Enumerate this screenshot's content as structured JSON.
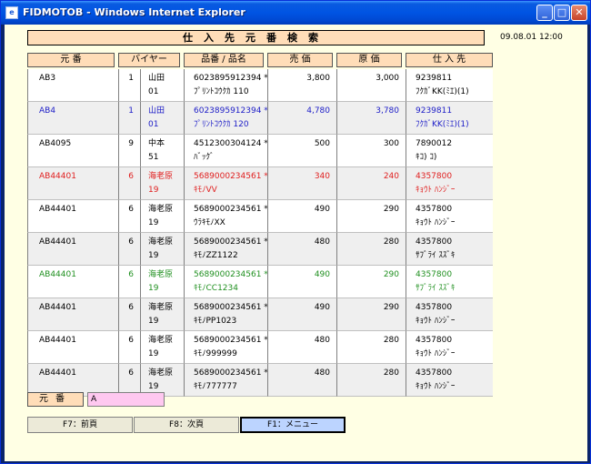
{
  "window": {
    "title": "FIDMOTOB - Windows Internet Explorer",
    "app_icon_glyph": "e",
    "minimize_glyph": "_",
    "maximize_glyph": "□",
    "close_glyph": "✕"
  },
  "page": {
    "heading": "仕入先元番検索",
    "datetime": "09.08.01 12:00"
  },
  "table": {
    "headers": [
      "元 番",
      "バイヤー",
      "品番 / 品名",
      "売 価",
      "原 価",
      "仕 入 先"
    ],
    "rows": [
      {
        "color": "#000000",
        "bg": "#ffffff",
        "code": "AB3",
        "buyer_no": "1",
        "buyer_name": "山田",
        "buyer_code": "01",
        "item_no": "6023895912394 *",
        "item_name": "ﾌﾟﾘﾝﾄｺｳｸｶ 110",
        "price": "3,800",
        "cost": "3,000",
        "supplier_no": "9239811",
        "supplier_name": "ﾌｸｶﾞKK(ﾐｴ)(1)"
      },
      {
        "color": "#2020c8",
        "bg": "#efefef",
        "code": "AB4",
        "buyer_no": "1",
        "buyer_name": "山田",
        "buyer_code": "01",
        "item_no": "6023895912394 *",
        "item_name": "ﾌﾟﾘﾝﾄｺｳｸｶ 120",
        "price": "4,780",
        "cost": "3,780",
        "supplier_no": "9239811",
        "supplier_name": "ﾌｸｶﾞKK(ﾐｴ)(1)"
      },
      {
        "color": "#000000",
        "bg": "#ffffff",
        "code": "AB4095",
        "buyer_no": "9",
        "buyer_name": "中本",
        "buyer_code": "51",
        "item_no": "4512300304124 *",
        "item_name": "ﾊﾞｯｸﾞ",
        "price": "500",
        "cost": "300",
        "supplier_no": "7890012",
        "supplier_name": "ｷｺ) ｺ)"
      },
      {
        "color": "#e02020",
        "bg": "#efefef",
        "code": "AB44401",
        "buyer_no": "6",
        "buyer_name": "海老原",
        "buyer_code": "19",
        "item_no": "5689000234561 *",
        "item_name": "ｷﾓﾉVV",
        "price": "340",
        "cost": "240",
        "supplier_no": "4357800",
        "supplier_name": "ｷｮｳﾄ ﾊﾝｼﾞｰ"
      },
      {
        "color": "#000000",
        "bg": "#ffffff",
        "code": "AB44401",
        "buyer_no": "6",
        "buyer_name": "海老原",
        "buyer_code": "19",
        "item_no": "5689000234561 *",
        "item_name": "ｳﾗｷﾓﾉXX",
        "price": "490",
        "cost": "290",
        "supplier_no": "4357800",
        "supplier_name": "ｷｮｳﾄ ﾊﾝｼﾞｰ"
      },
      {
        "color": "#000000",
        "bg": "#efefef",
        "code": "AB44401",
        "buyer_no": "6",
        "buyer_name": "海老原",
        "buyer_code": "19",
        "item_no": "5689000234561 *",
        "item_name": "ｷﾓﾉZZ1122",
        "price": "480",
        "cost": "280",
        "supplier_no": "4357800",
        "supplier_name": "ｻﾌﾞﾗｲ ｽｽﾞｷ"
      },
      {
        "color": "#209020",
        "bg": "#ffffff",
        "code": "AB44401",
        "buyer_no": "6",
        "buyer_name": "海老原",
        "buyer_code": "19",
        "item_no": "5689000234561 *",
        "item_name": "ｷﾓﾉCC1234",
        "price": "490",
        "cost": "290",
        "supplier_no": "4357800",
        "supplier_name": "ｻﾌﾞﾗｲ ｽｽﾞｷ"
      },
      {
        "color": "#000000",
        "bg": "#efefef",
        "code": "AB44401",
        "buyer_no": "6",
        "buyer_name": "海老原",
        "buyer_code": "19",
        "item_no": "5689000234561 *",
        "item_name": "ｷﾓﾉPP1023",
        "price": "490",
        "cost": "290",
        "supplier_no": "4357800",
        "supplier_name": "ｷｮｳﾄ ﾊﾝｼﾞｰ"
      },
      {
        "color": "#000000",
        "bg": "#ffffff",
        "code": "AB44401",
        "buyer_no": "6",
        "buyer_name": "海老原",
        "buyer_code": "19",
        "item_no": "5689000234561 *",
        "item_name": "ｷﾓﾉ999999",
        "price": "480",
        "cost": "280",
        "supplier_no": "4357800",
        "supplier_name": "ｷｮｳﾄ ﾊﾝｼﾞｰ"
      },
      {
        "color": "#000000",
        "bg": "#efefef",
        "code": "AB44401",
        "buyer_no": "6",
        "buyer_name": "海老原",
        "buyer_code": "19",
        "item_no": "5689000234561 *",
        "item_name": "ｷﾓﾉ777777",
        "price": "480",
        "cost": "280",
        "supplier_no": "4357800",
        "supplier_name": "ｷｮｳﾄ ﾊﾝｼﾞｰ"
      }
    ]
  },
  "search": {
    "label": "元番",
    "value": "A"
  },
  "buttons": {
    "f7_label": "F7：前頁",
    "f8_label": "F8：次頁",
    "f1_label": "F1：メニュー"
  },
  "colors": {
    "header_bg": "#ffddb8",
    "page_bg": "#ffffe4",
    "input_bg": "#ffc8f0",
    "active_button_bg": "#bcd4ff"
  }
}
